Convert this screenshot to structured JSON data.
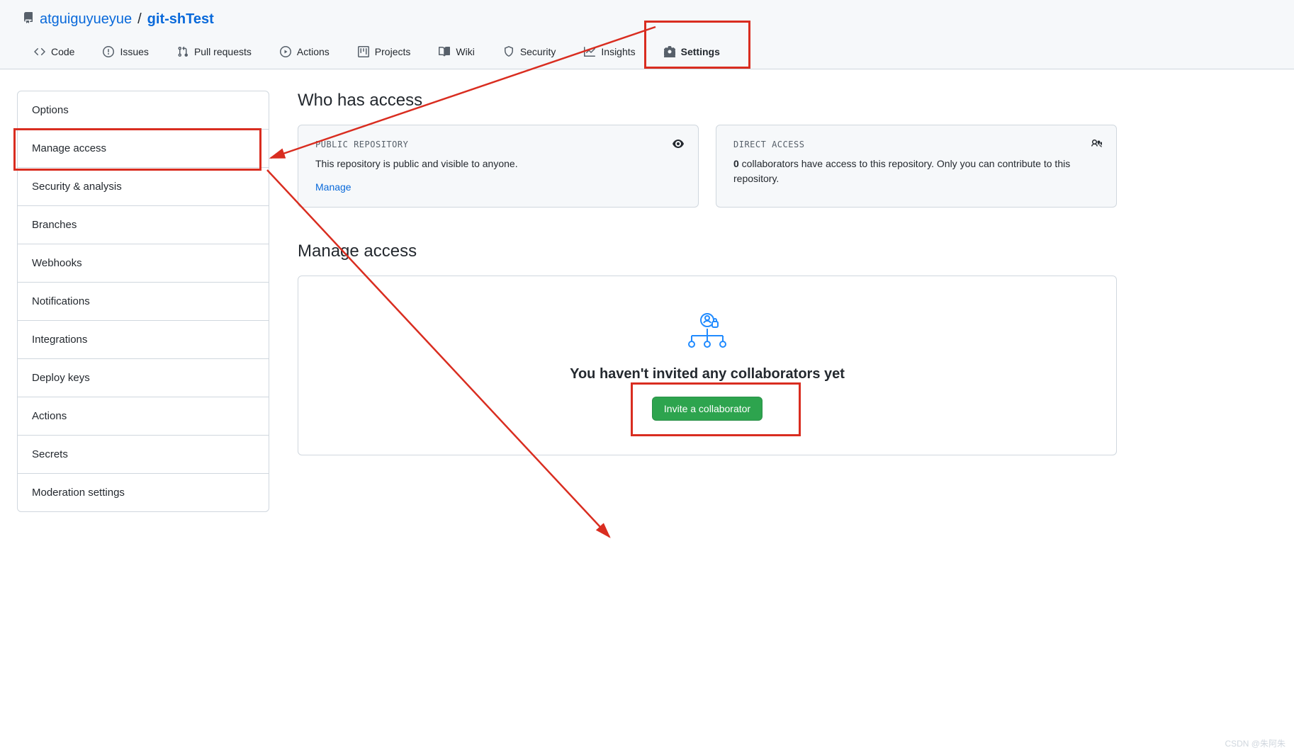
{
  "breadcrumb": {
    "owner": "atguiguyueyue",
    "sep": "/",
    "repo": "git-shTest"
  },
  "nav": [
    {
      "label": "Code"
    },
    {
      "label": "Issues"
    },
    {
      "label": "Pull requests"
    },
    {
      "label": "Actions"
    },
    {
      "label": "Projects"
    },
    {
      "label": "Wiki"
    },
    {
      "label": "Security"
    },
    {
      "label": "Insights"
    },
    {
      "label": "Settings"
    }
  ],
  "sidebar": {
    "items": [
      {
        "label": "Options"
      },
      {
        "label": "Manage access"
      },
      {
        "label": "Security & analysis"
      },
      {
        "label": "Branches"
      },
      {
        "label": "Webhooks"
      },
      {
        "label": "Notifications"
      },
      {
        "label": "Integrations"
      },
      {
        "label": "Deploy keys"
      },
      {
        "label": "Actions"
      },
      {
        "label": "Secrets"
      },
      {
        "label": "Moderation settings"
      }
    ]
  },
  "main": {
    "who_heading": "Who has access",
    "public_card": {
      "title": "PUBLIC REPOSITORY",
      "text": "This repository is public and visible to anyone.",
      "link": "Manage"
    },
    "direct_card": {
      "title": "DIRECT ACCESS",
      "count": "0",
      "text": " collaborators have access to this repository. Only you can contribute to this repository."
    },
    "manage_heading": "Manage access",
    "empty_heading": "You haven't invited any collaborators yet",
    "invite_label": "Invite a collaborator"
  },
  "watermark": "CSDN @朱阿朱"
}
